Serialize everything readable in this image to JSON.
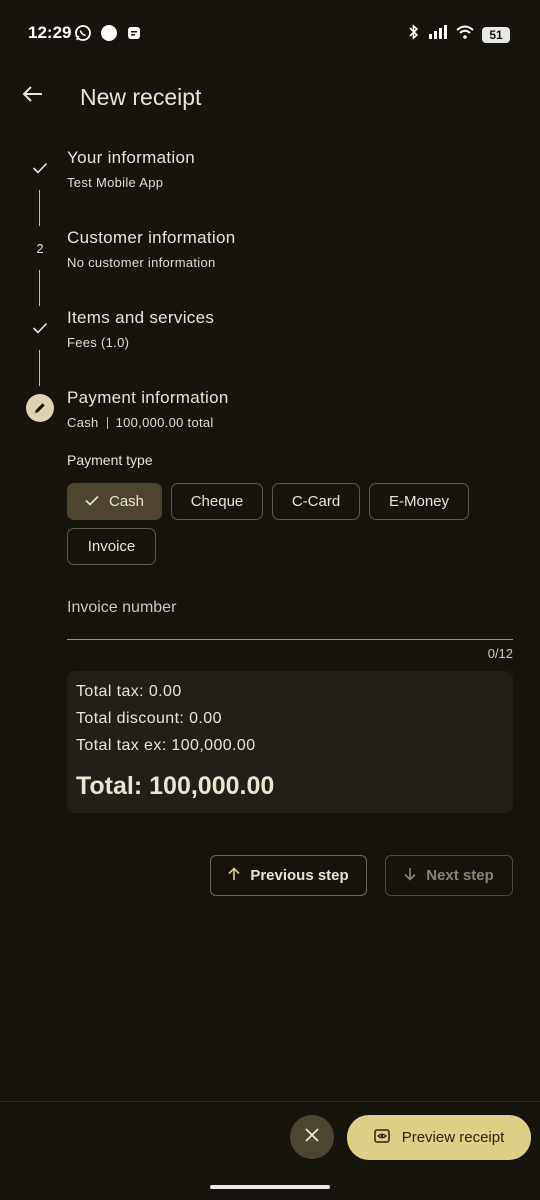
{
  "status_bar": {
    "time": "12:29",
    "battery": "51",
    "icons": [
      "whatsapp-icon",
      "dot-icon",
      "notes-icon",
      "bluetooth-icon",
      "signal-icon",
      "wifi-icon",
      "battery-icon"
    ]
  },
  "header": {
    "title": "New receipt",
    "back_icon": "back-arrow-icon"
  },
  "steps": [
    {
      "marker": "check",
      "title": "Your information",
      "subtitle": "Test Mobile App"
    },
    {
      "marker": "2",
      "title": "Customer information",
      "subtitle": "No customer information"
    },
    {
      "marker": "check",
      "title": "Items and services",
      "subtitle": "Fees (1.0)"
    },
    {
      "marker": "edit",
      "title": "Payment information",
      "subtitle_method": "Cash",
      "subtitle_total": "100,000.00 total"
    }
  ],
  "payment": {
    "label": "Payment type",
    "options": [
      "Cash",
      "Cheque",
      "C-Card",
      "E-Money",
      "Invoice"
    ],
    "selected": "Cash"
  },
  "invoice": {
    "label": "Invoice number",
    "value": "",
    "counter": "0/12"
  },
  "totals": {
    "tax": "Total tax: 0.00",
    "discount": "Total discount: 0.00",
    "tax_ex": "Total tax ex: 100,000.00",
    "total": "Total: 100,000.00"
  },
  "navigation": {
    "previous_label": "Previous step",
    "next_label": "Next step"
  },
  "actions": {
    "preview_label": "Preview receipt"
  },
  "colors": {
    "background": "#17140e",
    "accent": "#ddcf85",
    "selected_chip": "#4d4530",
    "text": "#ece4d2"
  }
}
